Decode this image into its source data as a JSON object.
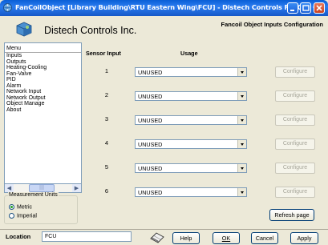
{
  "window": {
    "title": "FanCoilObject  [Library Building\\RTU Eastern Wing\\FCU] - Distech Controls FanCoil C..."
  },
  "header": {
    "company": "Distech Controls Inc.",
    "page_title": "Fancoil Object Inputs Configuration"
  },
  "menu": {
    "header": "Menu",
    "items": [
      "Inputs",
      "Outputs",
      "Heating-Cooling",
      "Fan-Valve",
      "PID",
      "Alarm",
      "Network Input",
      "Network Output",
      "Object Manage",
      "About"
    ]
  },
  "units": {
    "legend": "Measurement Units",
    "options": [
      "Metric",
      "Imperial"
    ],
    "selected": "Metric"
  },
  "table": {
    "col_sensor": "Sensor Input",
    "col_usage": "Usage",
    "configure_label": "Configure",
    "rows": [
      {
        "num": "1",
        "usage": "UNUSED"
      },
      {
        "num": "2",
        "usage": "UNUSED"
      },
      {
        "num": "3",
        "usage": "UNUSED"
      },
      {
        "num": "4",
        "usage": "UNUSED"
      },
      {
        "num": "5",
        "usage": "UNUSED"
      },
      {
        "num": "6",
        "usage": "UNUSED"
      }
    ]
  },
  "actions": {
    "refresh": "Refresh page",
    "help": "Help",
    "ok": "OK",
    "cancel": "Cancel",
    "apply": "Apply"
  },
  "location": {
    "label": "Location",
    "value": "FCU"
  },
  "colors": {
    "titlebar": "#0a5fd6",
    "background": "#ece9d8",
    "disabled_text": "#a7a69a"
  }
}
